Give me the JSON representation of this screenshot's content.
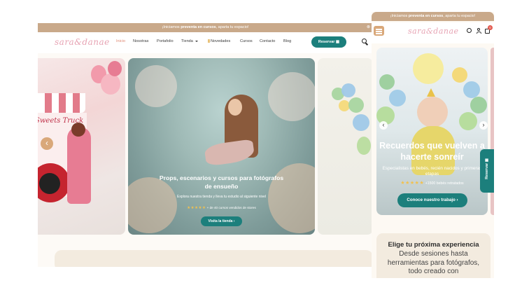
{
  "desktop": {
    "promo": {
      "prefix": "¡Iniciamos ",
      "bold": "preventa en cursos",
      "suffix": ", aparta tu espacio!",
      "close_glyph": "⊗"
    },
    "logo": "sara&danae",
    "nav": {
      "items": [
        {
          "label": "Inicio",
          "active": true
        },
        {
          "label": "Nosotras"
        },
        {
          "label": "Portafolio"
        },
        {
          "label": "Tienda"
        },
        {
          "label": "Novedades"
        },
        {
          "label": "Cursos"
        },
        {
          "label": "Contacto"
        },
        {
          "label": "Blog"
        }
      ],
      "reservar": "Reservar ▦"
    },
    "slider": {
      "left_text": "Sweets Truck",
      "center": {
        "title": "Props, escenarios y cursos para fotógrafos de ensueño",
        "subtitle": "Explora nuestra tienda y lleva tu estudio al siguiente nivel",
        "stars": "★★★★★",
        "rating": "+ de 40 cursos vendidos de stores",
        "button": "Visita la tienda ›"
      },
      "prev_arrow": "‹"
    }
  },
  "mobile": {
    "promo": {
      "prefix": "¡Iniciamos ",
      "bold": "preventa en cursos",
      "suffix": ", aparta tu espacio!"
    },
    "logo": "sara&danae",
    "cart_count": "0",
    "hero": {
      "title": "Recuerdos que vuelven a hacerte sonreír",
      "subtitle": "Especialistas en bebés, recién nacidos y primeras etapas",
      "stars": "★★★★★",
      "rating": "+1500 bebés retratados",
      "button": "Conoce nuestro trabajo ›",
      "prev_arrow": "‹",
      "next_arrow": "›"
    },
    "reservar_tab": "Reservar ▦",
    "card": {
      "title": "Elige tu próxima experiencia",
      "text": "Desde sesiones hasta herramientas para fotógrafos, todo creado con"
    }
  },
  "colors": {
    "promo_bg": "#c9a98a",
    "teal": "#1c7f7c",
    "logo_pink": "#e7a4b4",
    "cream": "#f3ebdf"
  }
}
